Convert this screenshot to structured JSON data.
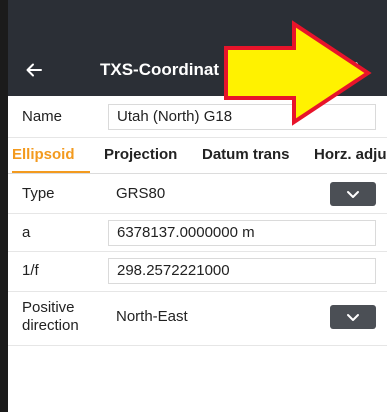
{
  "appbar": {
    "title": "TXS-Coordinat",
    "back_icon": "arrow-left-icon",
    "menu_icon": "more-vertical-icon"
  },
  "name_row": {
    "label": "Name",
    "value": "Utah (North) G18"
  },
  "tabs": [
    {
      "label": "Ellipsoid",
      "active": true
    },
    {
      "label": "Projection",
      "active": false
    },
    {
      "label": "Datum trans",
      "active": false
    },
    {
      "label": "Horz. adju",
      "active": false
    }
  ],
  "ellipsoid": {
    "type_label": "Type",
    "type_value": "GRS80",
    "a_label": "a",
    "a_value": "6378137.0000000 m",
    "f_label": "1/f",
    "f_value": "298.2572221000",
    "direction_label_line1": "Positive",
    "direction_label_line2": "direction",
    "direction_value": "North-East"
  },
  "colors": {
    "appbar": "#2b2f36",
    "accent": "#f39a1e",
    "annotation_fill": "#fff200",
    "annotation_stroke": "#e8142a"
  }
}
